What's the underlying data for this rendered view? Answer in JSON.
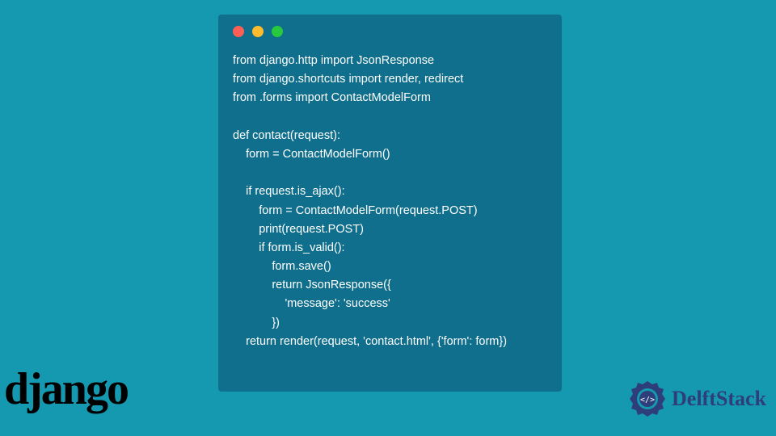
{
  "code": {
    "lines": [
      "from django.http import JsonResponse",
      "from django.shortcuts import render, redirect",
      "from .forms import ContactModelForm",
      "",
      "def contact(request):",
      "    form = ContactModelForm()",
      "",
      "    if request.is_ajax():",
      "        form = ContactModelForm(request.POST)",
      "        print(request.POST)",
      "        if form.is_valid():",
      "            form.save()",
      "            return JsonResponse({",
      "                'message': 'success'",
      "            })",
      "    return render(request, 'contact.html', {'form': form})"
    ]
  },
  "logos": {
    "django": "django",
    "delftstack": "DelftStack"
  },
  "colors": {
    "page_bg": "#1599b1",
    "panel_bg": "#0f6f8c",
    "code_text": "#ffffff",
    "dot_red": "#ff5f56",
    "dot_yellow": "#ffbd2e",
    "dot_green": "#27c93f",
    "delft_blue": "#2d3e7a"
  }
}
